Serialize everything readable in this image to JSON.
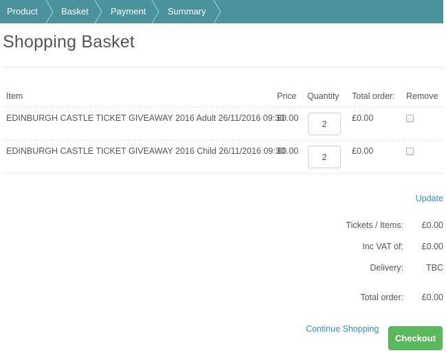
{
  "breadcrumb": {
    "steps": [
      {
        "label": "Product"
      },
      {
        "label": "Basket"
      },
      {
        "label": "Payment"
      },
      {
        "label": "Summary"
      }
    ]
  },
  "colors": {
    "header_bar": "#4a929c",
    "link": "#2f8fc4",
    "checkout_button": "#5cb85c"
  },
  "page": {
    "title": "Shopping Basket"
  },
  "table": {
    "headers": {
      "item": "Item",
      "price": "Price",
      "quantity": "Quantity",
      "total": "Total order:",
      "remove": "Remove"
    },
    "rows": [
      {
        "item": "EDINBURGH CASTLE TICKET GIVEAWAY 2016 Adult 26/11/2016 09:30",
        "price": "£0.00",
        "quantity": "2",
        "total": "£0.00",
        "remove": false
      },
      {
        "item": "EDINBURGH CASTLE TICKET GIVEAWAY 2016 Child 26/11/2016 09:30",
        "price": "£0.00",
        "quantity": "2",
        "total": "£0.00",
        "remove": false
      }
    ]
  },
  "actions": {
    "update": "Update",
    "continue_shopping": "Continue Shopping",
    "checkout": "Checkout"
  },
  "summary": {
    "tickets_label": "Tickets / Items:",
    "tickets_value": "£0.00",
    "vat_label": "Inc VAT of:",
    "vat_value": "£0.00",
    "delivery_label": "Delivery:",
    "delivery_value": "TBC",
    "total_label": "Total order:",
    "total_value": "£0.00"
  }
}
